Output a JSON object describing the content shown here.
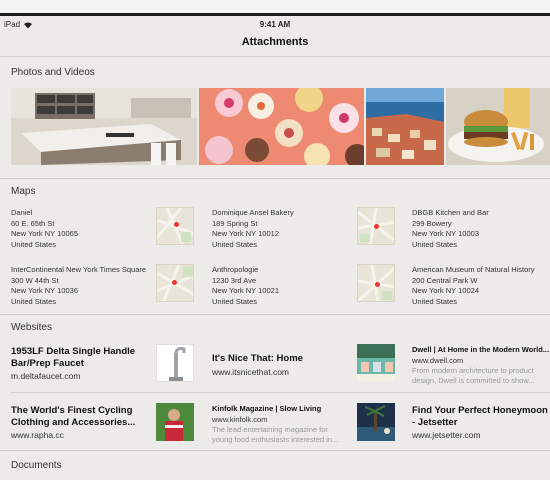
{
  "status_bar": {
    "device": "iPad",
    "time": "9:41 AM"
  },
  "nav": {
    "title": "Attachments"
  },
  "sections": {
    "photos": "Photos and Videos",
    "maps": "Maps",
    "websites": "Websites",
    "documents": "Documents"
  },
  "photos": [
    {
      "subject": "kitchen"
    },
    {
      "subject": "cupcakes"
    },
    {
      "subject": "harbor"
    },
    {
      "subject": "burger"
    }
  ],
  "maps": [
    {
      "name": "Daniel",
      "address": "60 E. 65th St",
      "city": "New York NY 10065",
      "country": "United States"
    },
    {
      "name": "Dominique Ansel Bakery",
      "address": "189 Spring St",
      "city": "New York NY 10012",
      "country": "United States"
    },
    {
      "name": "DBGB Kitchen and Bar",
      "address": "299 Bowery",
      "city": "New York NY 10003",
      "country": "United States"
    },
    {
      "name": "InterContinental New York Times Square",
      "address": "300 W 44th St",
      "city": "New York NY 10036",
      "country": "United States"
    },
    {
      "name": "Anthropologie",
      "address": "1230 3rd Ave",
      "city": "New York NY 10021",
      "country": "United States"
    },
    {
      "name": "American Museum of Natural History",
      "address": "200 Central Park W",
      "city": "New York NY 10024",
      "country": "United States"
    }
  ],
  "websites": [
    {
      "title_line1": "1953LF Delta Single Handle",
      "title_line2": "Bar/Prep Faucet",
      "url": "m.deltafaucet.com"
    },
    {
      "title_line1": "It's Nice That: Home",
      "url": "www.itsnicethat.com"
    },
    {
      "title": "Dwell | At Home in the Modern World...",
      "url": "www.dwell.com",
      "desc_line1": "From modern architecture to product",
      "desc_line2": "design, Dwell is committed to show..."
    },
    {
      "title_line1": "The World's Finest Cycling",
      "title_line2": "Clothing and Accessories...",
      "url": "www.rapha.cc"
    },
    {
      "title": "Kinfolk Magazine | Slow Living",
      "url": "www.kinfolk.com",
      "desc_line1": "The lead entertaining magazine for",
      "desc_line2": "young food enthusiasts interested in..."
    },
    {
      "title_line1": "Find Your Perfect Honeymoon",
      "title_line2": "- Jetsetter",
      "url": "www.jetsetter.com"
    }
  ]
}
